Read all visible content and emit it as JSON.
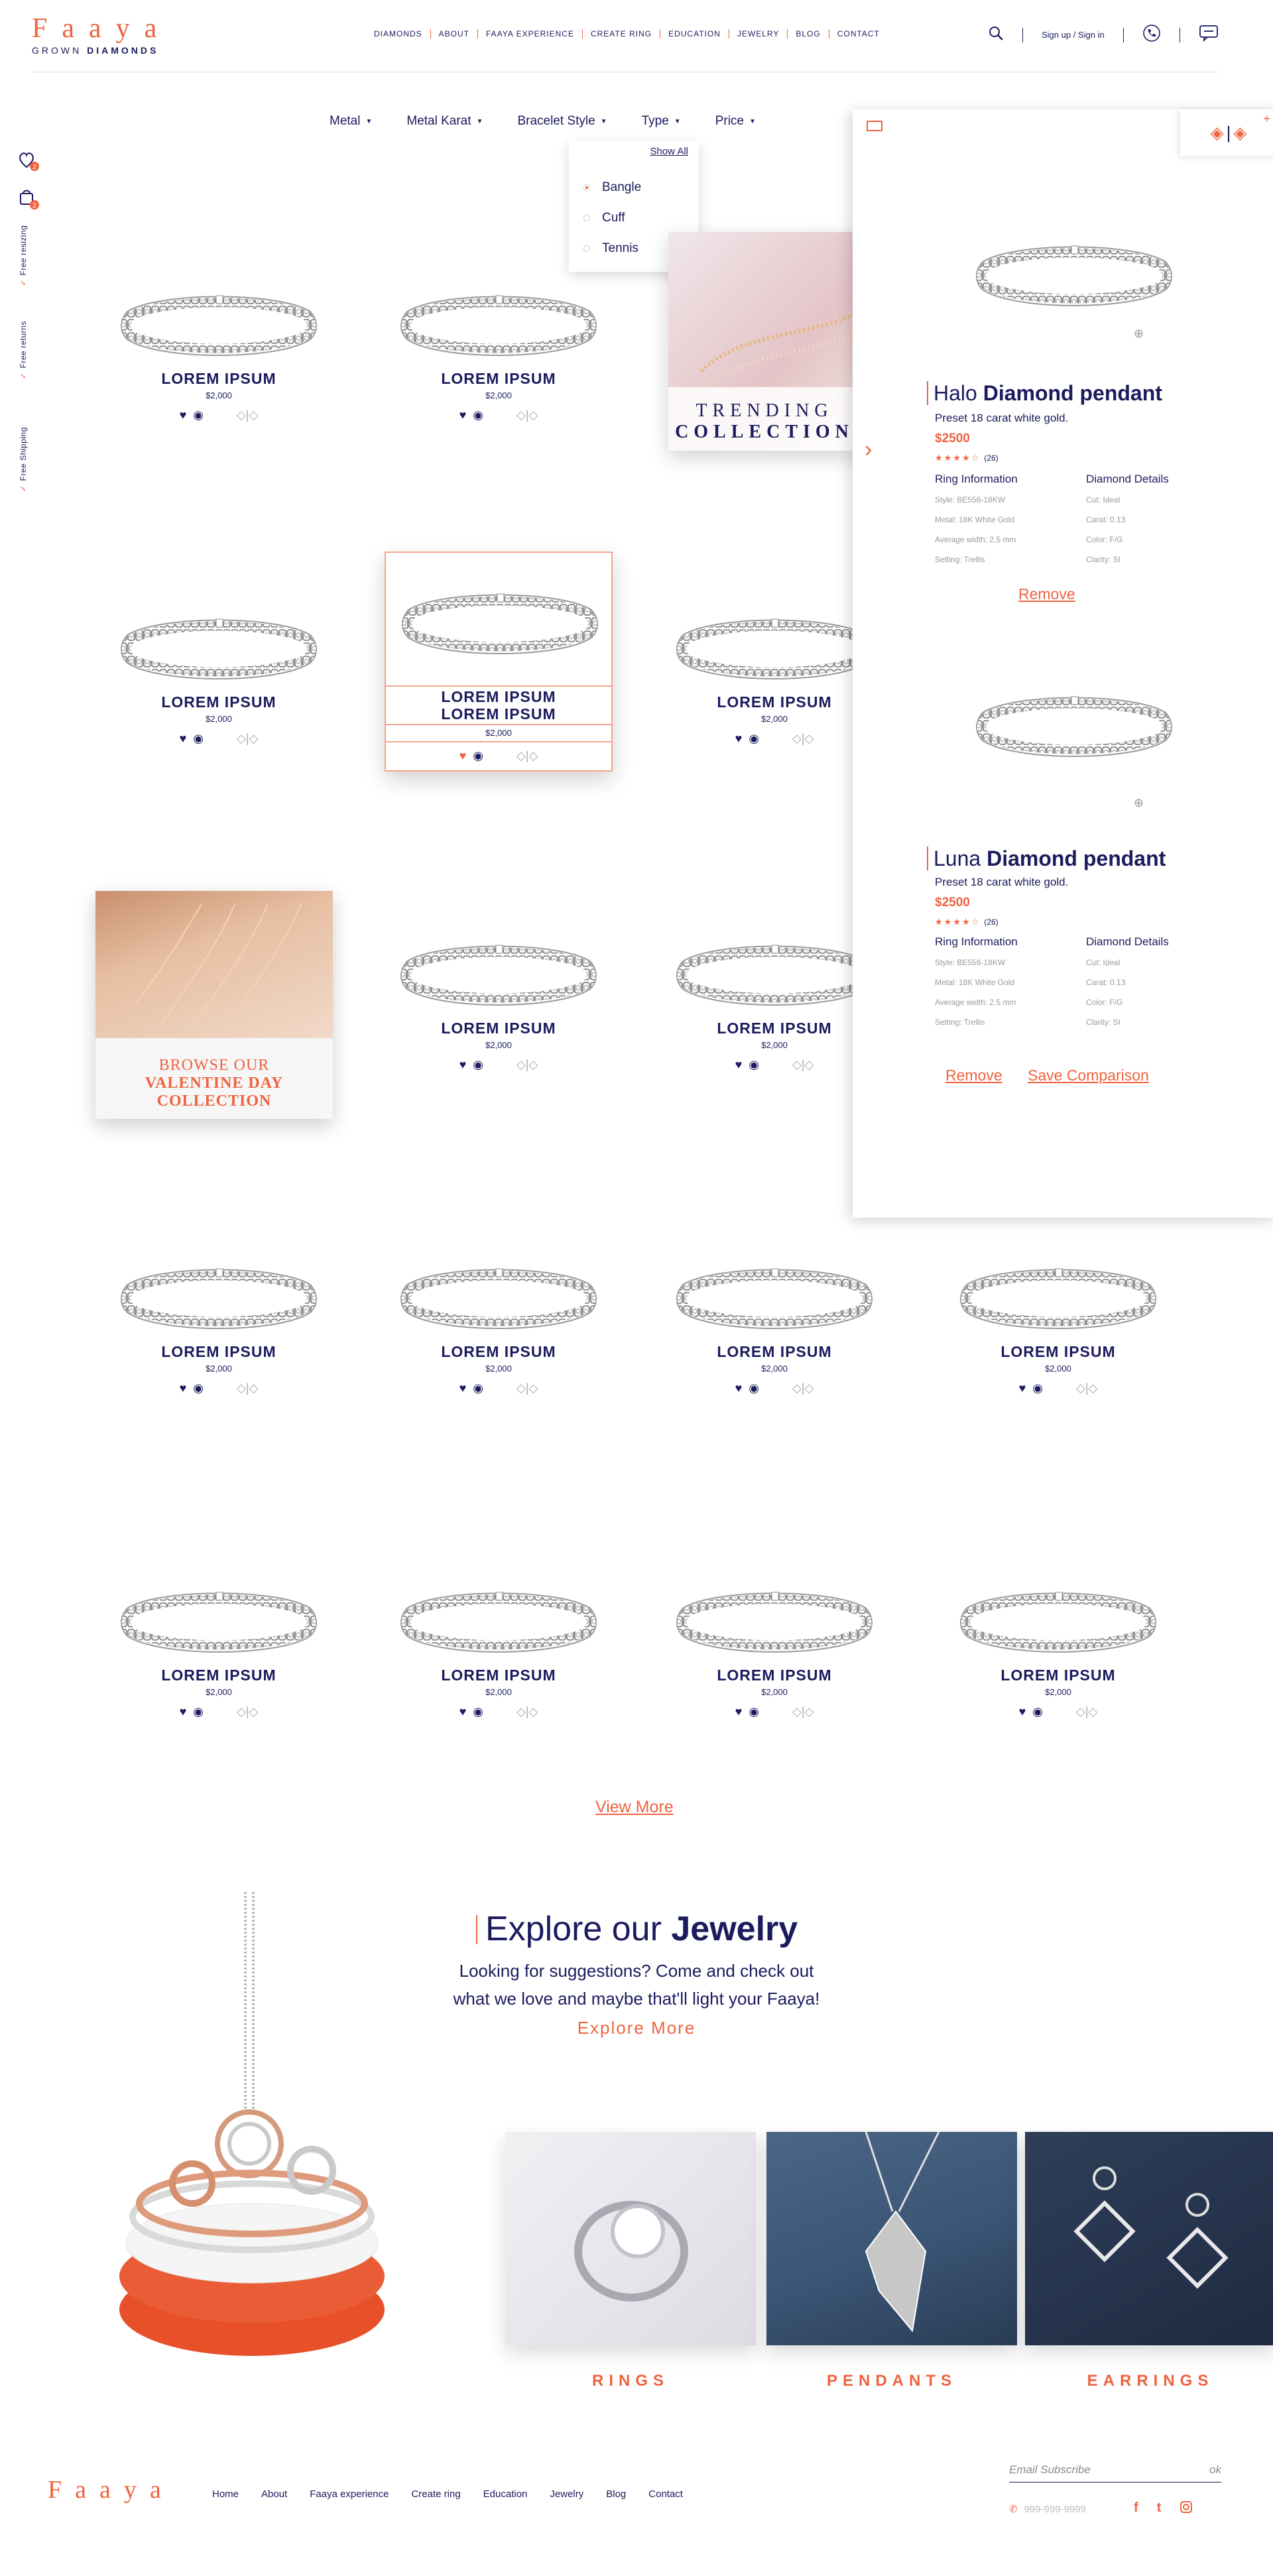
{
  "brand": {
    "name": "Faaya",
    "tag_light": "GROWN",
    "tag_bold": "DIAMONDS"
  },
  "nav": [
    "Diamonds",
    "About",
    "Faaya experience",
    "Create ring",
    "Education",
    "Jewelry",
    "Blog",
    "Contact"
  ],
  "header": {
    "signin": "Sign up / Sign in"
  },
  "filters": [
    "Metal",
    "Metal Karat",
    "Bracelet Style",
    "Type",
    "Price"
  ],
  "dropdown": {
    "show_all": "Show All",
    "options": [
      "Bangle",
      "Cuff",
      "Tennis"
    ],
    "selected": "Bangle"
  },
  "rail": {
    "wishlist_count": "2",
    "cart_count": "2",
    "perks": [
      "Free resizing",
      "Free returns",
      "Free Shipping"
    ]
  },
  "product": {
    "name": "LOREM IPSUM",
    "price": "$2,000"
  },
  "promo": {
    "trending_1": "TRENDING",
    "trending_2": "COLLECTION",
    "valentine_1": "BROWSE OUR",
    "valentine_2": "VALENTINE DAY",
    "valentine_3": "COLLECTION"
  },
  "compare": {
    "items": [
      {
        "name_light": "Halo",
        "name_bold": "Diamond pendant",
        "subtitle": "Preset 18 carat white gold.",
        "price": "$2500",
        "rating": "★★★★☆",
        "reviews": "(26)",
        "ring_title": "Ring Information",
        "ring_specs": [
          "Style: BE556-18KW",
          "Metal: 18K White Gold",
          "Average width: 2.5 mm",
          "Setting: Trellis"
        ],
        "diamond_title": "Diamond Details",
        "diamond_specs": [
          "Cut: Ideal",
          "Carat: 0.13",
          "Color: F/G",
          "Clarity: SI"
        ]
      },
      {
        "name_light": "Luna",
        "name_bold": "Diamond pendant",
        "subtitle": "Preset 18 carat white gold.",
        "price": "$2500",
        "rating": "★★★★☆",
        "reviews": "(26)",
        "ring_title": "Ring Information",
        "ring_specs": [
          "Style: BE556-18KW",
          "Metal: 18K White Gold",
          "Average width: 2.5 mm",
          "Setting: Trellis"
        ],
        "diamond_title": "Diamond Details",
        "diamond_specs": [
          "Cut: Ideal",
          "Carat: 0.13",
          "Color: F/G",
          "Clarity: SI"
        ]
      }
    ],
    "remove": "Remove",
    "save": "Save Comparison"
  },
  "view_more": "View More",
  "explore": {
    "title_light": "Explore our",
    "title_bold": "Jewelry",
    "desc_1": "Looking for suggestions? Come and check out",
    "desc_2": "what we love and maybe that'll light your Faaya!",
    "link": "Explore More"
  },
  "categories": [
    "RINGS",
    "PENDANTS",
    "EARRINGS"
  ],
  "footer": {
    "brand": "Faaya",
    "nav": [
      "Home",
      "About",
      "Faaya experience",
      "Create ring",
      "Education",
      "Jewelry",
      "Blog",
      "Contact"
    ],
    "email_placeholder": "Email Subscribe",
    "ok": "ok",
    "phone": "999-999-9999"
  },
  "colors": {
    "navy": "#1b1b5e",
    "accent": "#ef6340"
  }
}
